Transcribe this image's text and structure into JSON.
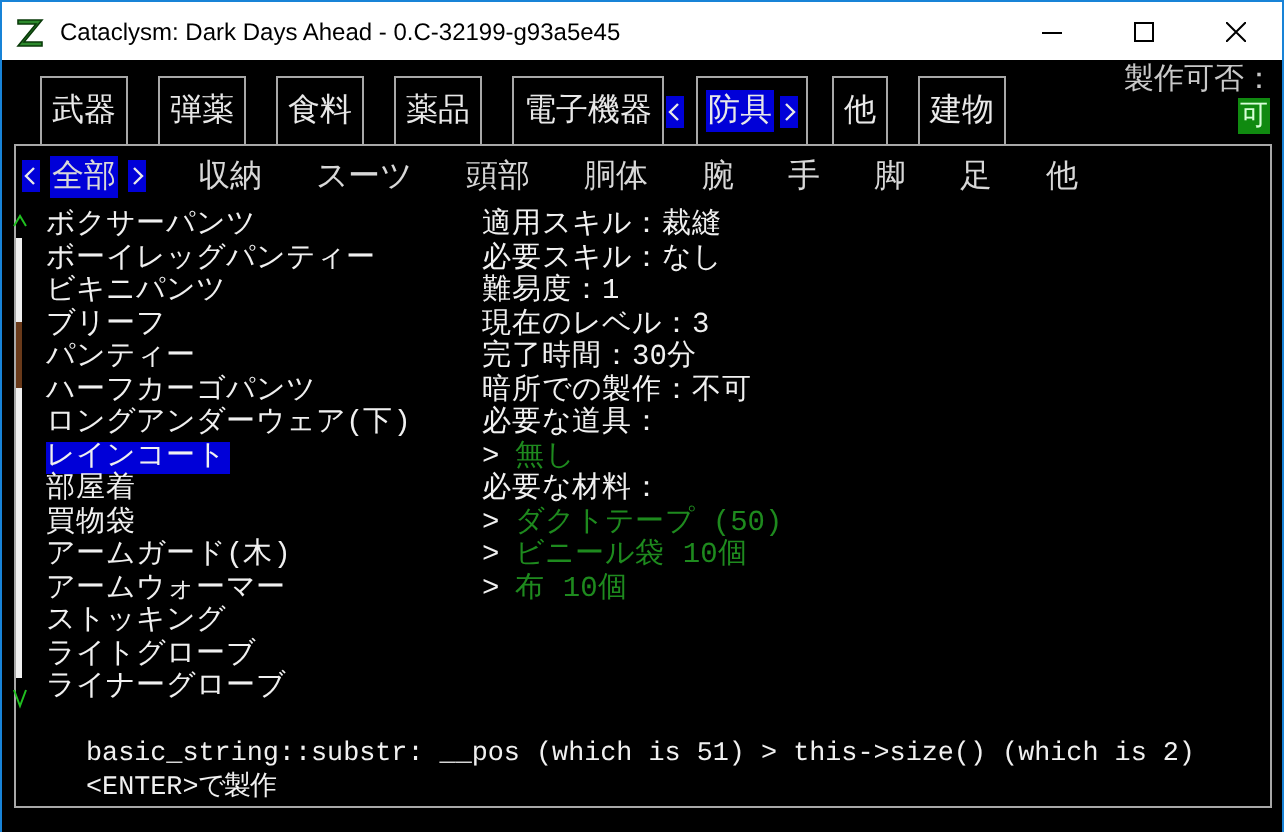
{
  "window": {
    "title": "Cataclysm: Dark Days Ahead - 0.C-32199-g93a5e45"
  },
  "tabs": [
    {
      "label": "武器",
      "selected": false
    },
    {
      "label": "弾薬",
      "selected": false
    },
    {
      "label": "食料",
      "selected": false
    },
    {
      "label": "薬品",
      "selected": false
    },
    {
      "label": "電子機器",
      "selected": false
    },
    {
      "label": "防具",
      "selected": true
    },
    {
      "label": "他",
      "selected": false
    },
    {
      "label": "建物",
      "selected": false
    }
  ],
  "craftable": {
    "label": "製作可否：",
    "value": "可"
  },
  "subtabs": [
    {
      "label": "全部",
      "selected": true
    },
    {
      "label": "収納",
      "selected": false
    },
    {
      "label": "スーツ",
      "selected": false
    },
    {
      "label": "頭部",
      "selected": false
    },
    {
      "label": "胴体",
      "selected": false
    },
    {
      "label": "腕",
      "selected": false
    },
    {
      "label": "手",
      "selected": false
    },
    {
      "label": "脚",
      "selected": false
    },
    {
      "label": "足",
      "selected": false
    },
    {
      "label": "他",
      "selected": false
    }
  ],
  "recipes": [
    {
      "name": "ボクサーパンツ",
      "selected": false
    },
    {
      "name": "ボーイレッグパンティー",
      "selected": false
    },
    {
      "name": "ビキニパンツ",
      "selected": false
    },
    {
      "name": "ブリーフ",
      "selected": false
    },
    {
      "name": "パンティー",
      "selected": false
    },
    {
      "name": "ハーフカーゴパンツ",
      "selected": false
    },
    {
      "name": "ロングアンダーウェア(下)",
      "selected": false
    },
    {
      "name": "レインコート",
      "selected": true
    },
    {
      "name": "部屋着",
      "selected": false
    },
    {
      "name": "買物袋",
      "selected": false
    },
    {
      "name": "アームガード(木)",
      "selected": false
    },
    {
      "name": "アームウォーマー",
      "selected": false
    },
    {
      "name": "ストッキング",
      "selected": false
    },
    {
      "name": "ライトグローブ",
      "selected": false
    },
    {
      "name": "ライナーグローブ",
      "selected": false
    }
  ],
  "details": [
    {
      "kind": "info",
      "text": "適用スキル：裁縫"
    },
    {
      "kind": "info",
      "text": "必要スキル：なし"
    },
    {
      "kind": "info",
      "text": "難易度：1"
    },
    {
      "kind": "info",
      "text": "現在のレベル：3"
    },
    {
      "kind": "info",
      "text": "完了時間：30分"
    },
    {
      "kind": "info",
      "text": "暗所での製作：不可"
    },
    {
      "kind": "info",
      "text": "必要な道具："
    },
    {
      "kind": "requirement",
      "marker": ">",
      "text": "無し"
    },
    {
      "kind": "info",
      "text": "必要な材料："
    },
    {
      "kind": "requirement",
      "marker": ">",
      "text": "ダクトテープ (50)"
    },
    {
      "kind": "requirement",
      "marker": ">",
      "text": "ビニール袋 10個"
    },
    {
      "kind": "requirement",
      "marker": ">",
      "text": "布 10個"
    }
  ],
  "message": "basic_string::substr: __pos (which is 51) > this->size() (which is 2)",
  "hint": "<ENTER>で製作"
}
